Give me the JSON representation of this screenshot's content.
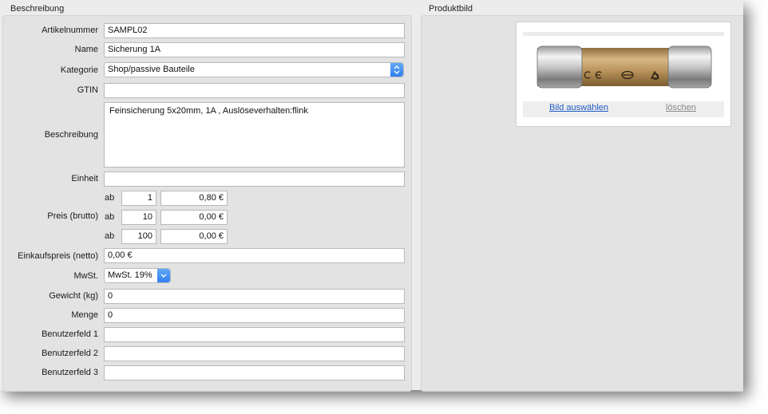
{
  "left_group": {
    "title": "Beschreibung"
  },
  "right_group": {
    "title": "Produktbild"
  },
  "fields": {
    "artikelnummer": {
      "label": "Artikelnummer",
      "value": "SAMPL02"
    },
    "name": {
      "label": "Name",
      "value": "Sicherung 1A"
    },
    "kategorie": {
      "label": "Kategorie",
      "value": "Shop/passive Bauteile"
    },
    "gtin": {
      "label": "GTIN",
      "value": ""
    },
    "beschreibung": {
      "label": "Beschreibung",
      "value": "Feinsicherung 5x20mm, 1A , Auslöseverhalten:flink"
    },
    "einheit": {
      "label": "Einheit",
      "value": ""
    },
    "preis": {
      "label": "Preis (brutto)",
      "rows": [
        {
          "prefix": "ab",
          "qty": "1",
          "price": "0,80 €"
        },
        {
          "prefix": "ab",
          "qty": "10",
          "price": "0,00 €"
        },
        {
          "prefix": "ab",
          "qty": "100",
          "price": "0,00 €"
        }
      ]
    },
    "einkaufspreis": {
      "label": "Einkaufspreis (netto)",
      "value": "0,00 €"
    },
    "mwst": {
      "label": "MwSt.",
      "value": "MwSt. 19%"
    },
    "gewicht": {
      "label": "Gewicht (kg)",
      "value": "0"
    },
    "menge": {
      "label": "Menge",
      "value": "0"
    },
    "benutzerfeld1": {
      "label": "Benutzerfeld 1",
      "value": ""
    },
    "benutzerfeld2": {
      "label": "Benutzerfeld 2",
      "value": ""
    },
    "benutzerfeld3": {
      "label": "Benutzerfeld 3",
      "value": ""
    }
  },
  "image": {
    "choose_label": "Bild auswählen",
    "delete_label": "löschen",
    "fuse_markings": [
      "CE",
      "fuse-symbol",
      "vde-symbol"
    ]
  },
  "colors": {
    "link": "#1f5bc4",
    "link_disabled": "#8a8a8a",
    "select_accent": "#2f7ff0",
    "fuse_body": "#b9935a"
  }
}
